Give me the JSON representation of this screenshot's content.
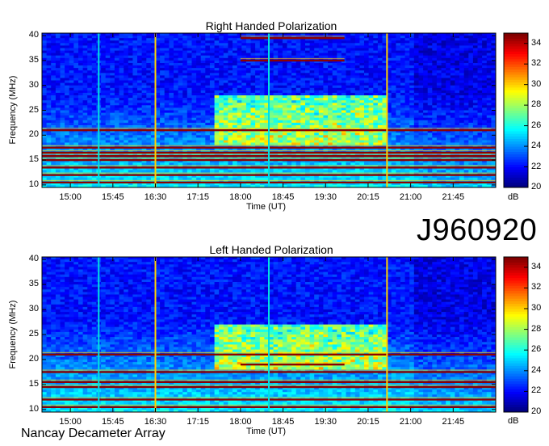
{
  "observation_id": "J960920",
  "footer": "Nancay Decameter Array",
  "chart_data": [
    {
      "type": "heatmap",
      "title": "Right Handed Polarization",
      "ylabel": "Frequency (MHz)",
      "xlabel": "Time (UT)",
      "ylim": [
        9.5,
        40.5
      ],
      "xlim": [
        "14:30",
        "22:30"
      ],
      "yticks": [
        "10",
        "15",
        "20",
        "25",
        "30",
        "35",
        "40"
      ],
      "xticks": [
        "15:00",
        "15:45",
        "16:30",
        "17:15",
        "18:00",
        "18:45",
        "19:30",
        "20:15",
        "21:00",
        "21:45"
      ],
      "colorbar": {
        "label": "dB",
        "range": [
          20,
          35
        ],
        "ticks": [
          "20",
          "22",
          "24",
          "26",
          "28",
          "30",
          "32",
          "34"
        ]
      },
      "strong_bands_mhz": [
        10.5,
        12,
        13.5,
        15,
        15.8,
        16.5,
        17.5,
        21,
        35,
        39.5
      ],
      "burst_band_mhz": [
        18,
        28
      ],
      "burst_time": [
        "17:30",
        "20:30"
      ],
      "interference_times": [
        "15:30",
        "16:30",
        "18:30",
        "20:35"
      ]
    },
    {
      "type": "heatmap",
      "title": "Left Handed Polarization",
      "ylabel": "Frequency (MHz)",
      "xlabel": "Time (UT)",
      "ylim": [
        9.5,
        40.5
      ],
      "xlim": [
        "14:30",
        "22:30"
      ],
      "yticks": [
        "10",
        "15",
        "20",
        "25",
        "30",
        "35",
        "40"
      ],
      "xticks": [
        "15:00",
        "15:45",
        "16:30",
        "17:15",
        "18:00",
        "18:45",
        "19:30",
        "20:15",
        "21:00",
        "21:45"
      ],
      "colorbar": {
        "label": "dB",
        "range": [
          20,
          35
        ],
        "ticks": [
          "20",
          "22",
          "24",
          "26",
          "28",
          "30",
          "32",
          "34"
        ]
      },
      "strong_bands_mhz": [
        10.5,
        12,
        14.5,
        15.5,
        17.5,
        19,
        21
      ],
      "burst_band_mhz": [
        18,
        27
      ],
      "burst_time": [
        "17:30",
        "20:30"
      ],
      "interference_times": [
        "15:30",
        "16:30",
        "18:30",
        "20:35"
      ]
    }
  ]
}
